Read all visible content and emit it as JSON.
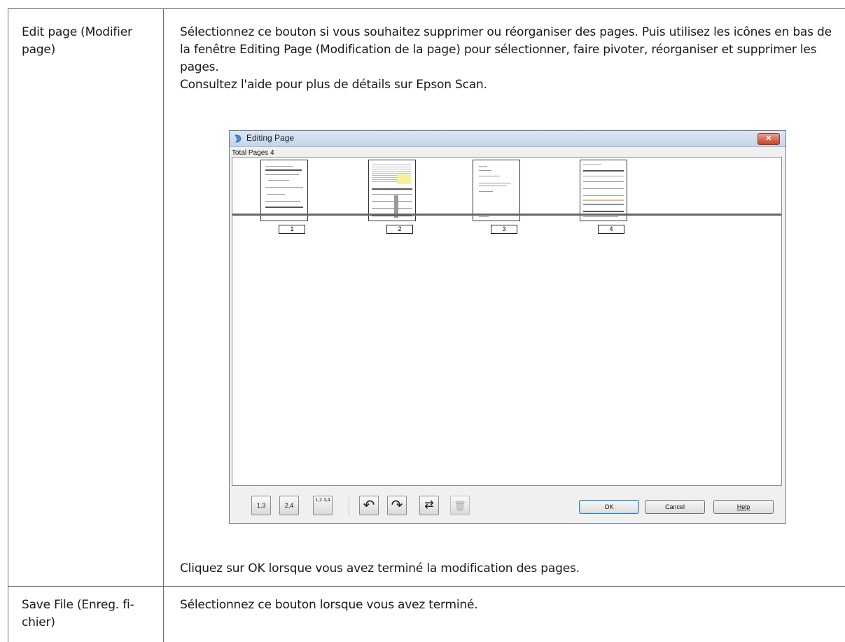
{
  "table": {
    "rows": [
      {
        "label": "Edit page (Modifier page)",
        "description": [
          "Sélectionnez ce bouton si vous souhaitez supprimer ou réorganiser des pages. Puis utilisez les icônes en bas de la fenêtre Editing Page (Modification de la page) pour sélectionner, faire pivoter, réorganiser et supprimer les pages.",
          "Consultez l'aide pour plus de détails sur Epson Scan."
        ],
        "closing": "Cliquez sur OK lorsque vous avez terminé la modification des pages."
      },
      {
        "label": "Save File (Enreg. fi-chier)",
        "description": "Sélectionnez ce bouton lorsque vous avez terminé."
      }
    ]
  },
  "dialog": {
    "title": "Editing Page",
    "total_pages_label": "Total Pages 4",
    "pages": [
      "1",
      "2",
      "3",
      "4"
    ],
    "toolbar_icons": [
      "select-odd-pages-icon",
      "select-even-pages-icon",
      "select-all-pages-icon",
      "rotate-left-icon",
      "rotate-right-icon",
      "reorder-icon",
      "delete-icon"
    ],
    "toolbar_glyphs": [
      "1,3",
      "2,4",
      "1,2 3,4",
      "↶",
      "↷",
      "⇄",
      "🗑"
    ],
    "buttons": {
      "ok": "OK",
      "cancel": "Cancel",
      "help": "Help"
    },
    "close_glyph": "✕"
  }
}
